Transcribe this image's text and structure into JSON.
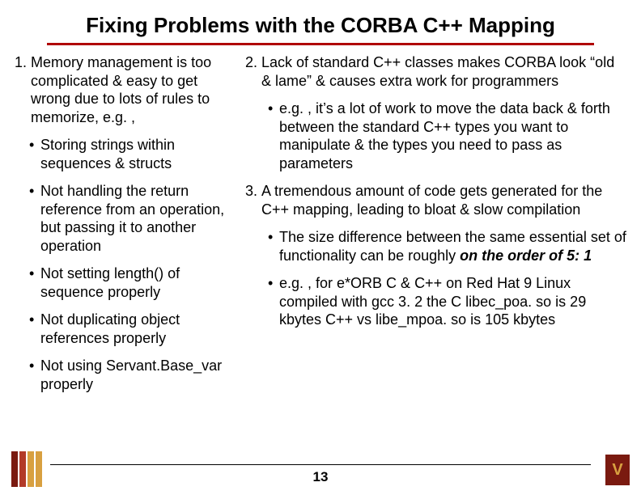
{
  "title": "Fixing Problems with the CORBA C++ Mapping",
  "left": {
    "p1_num": "1.",
    "p1_txt": "Memory management is too complicated & easy to get wrong due to lots of rules to memorize, e.g. ,",
    "b1_dot": "•",
    "b1_txt": "Storing strings within sequences & structs",
    "b2_dot": "•",
    "b2_txt": "Not handling the return reference from an operation, but passing it to another operation",
    "b3_dot": "•",
    "b3_txt": "Not setting length() of sequence properly",
    "b4_dot": "•",
    "b4_txt": "Not duplicating object references properly",
    "b5_dot": "•",
    "b5_txt": "Not using Servant.Base_var properly"
  },
  "right": {
    "p2_num": "2.",
    "p2_txt": "Lack of standard C++ classes makes CORBA look “old & lame” & causes extra work for programmers",
    "b6_dot": "•",
    "b6_txt": "e.g. , it’s a lot of work to move the data back & forth between the standard C++ types you want to manipulate & the types you need to pass as parameters",
    "p3_num": "3.",
    "p3_txt": "A tremendous amount of code gets generated for the C++ mapping, leading to bloat & slow compilation",
    "b7_dot": "•",
    "b7_pre": "The size difference between the same essential set of functionality can be roughly ",
    "b7_em": "on the order of 5: 1",
    "b8_dot": "•",
    "b8_txt": "e.g. , for e*ORB C & C++ on Red Hat 9 Linux compiled with gcc 3. 2 the C libec_poa. so is 29 kbytes C++ vs libe_mpoa. so is 105 kbytes"
  },
  "page": "13",
  "logo_right_letter": "V"
}
